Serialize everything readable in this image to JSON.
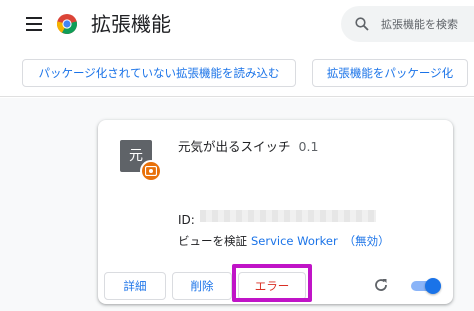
{
  "header": {
    "title": "拡張機能",
    "menu_icon": "hamburger-icon",
    "logo_icon": "chrome-logo-icon"
  },
  "search": {
    "placeholder": "拡張機能を検索",
    "value": "",
    "icon": "search-icon"
  },
  "toolbar": {
    "load_unpacked_label": "パッケージ化されていない拡張機能を読み込む",
    "pack_label": "拡張機能をパッケージ化"
  },
  "extension": {
    "icon_text": "元",
    "badge_icon": "error-badge-icon",
    "name": "元気が出るスイッチ",
    "version": "0.1",
    "id_label": "ID:",
    "id_value": "",
    "inspect_label": "ビューを検証",
    "inspect_link": "Service Worker",
    "inactive_label": "（無効）",
    "details_label": "詳細",
    "remove_label": "削除",
    "errors_label": "エラー",
    "reload_icon": "reload-icon",
    "enabled": true
  },
  "colors": {
    "accent": "#1a73e8",
    "error": "#d93025",
    "highlight": "#c014c7",
    "badge": "#e8710a"
  }
}
